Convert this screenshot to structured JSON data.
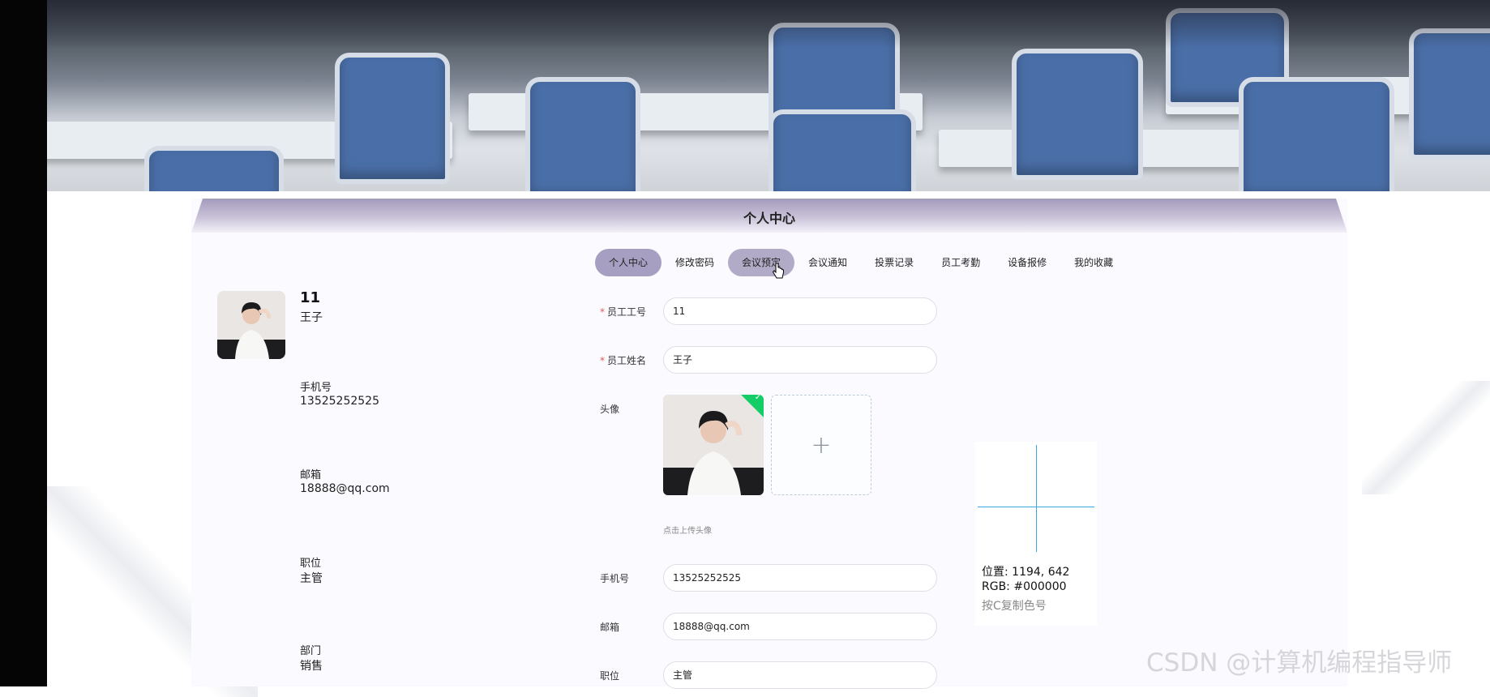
{
  "page": {
    "title": "个人中心"
  },
  "tabs": [
    {
      "label": "个人中心"
    },
    {
      "label": "修改密码"
    },
    {
      "label": "会议预定"
    },
    {
      "label": "会议通知"
    },
    {
      "label": "投票记录"
    },
    {
      "label": "员工考勤"
    },
    {
      "label": "设备报修"
    },
    {
      "label": "我的收藏"
    }
  ],
  "profile": {
    "employee_id": "11",
    "name": "王子",
    "phone_label": "手机号",
    "phone": "13525252525",
    "email_label": "邮箱",
    "email": "18888@qq.com",
    "position_label": "职位",
    "position": "主管",
    "department_label": "部门",
    "department": "销售"
  },
  "form": {
    "employee_id_label": "员工工号",
    "employee_id_value": "11",
    "name_label": "员工姓名",
    "name_value": "王子",
    "avatar_label": "头像",
    "upload_hint": "点击上传头像",
    "upload_plus": "+",
    "upload_check": "✓",
    "phone_label": "手机号",
    "phone_value": "13525252525",
    "email_label": "邮箱",
    "email_value": "18888@qq.com",
    "position_label": "职位",
    "position_value": "主管"
  },
  "color_picker": {
    "position_text": "位置: 1194, 642",
    "rgb_text": "RGB: #000000",
    "hint_text": "按C复制色号"
  },
  "watermark": "CSDN @计算机编程指导师",
  "colors": {
    "tab_active": "#a69fc1",
    "title_bar": "#a39bbb",
    "required_star": "#e05a5a",
    "upload_success": "#13ce66",
    "crosshair": "#3ba7e0"
  }
}
